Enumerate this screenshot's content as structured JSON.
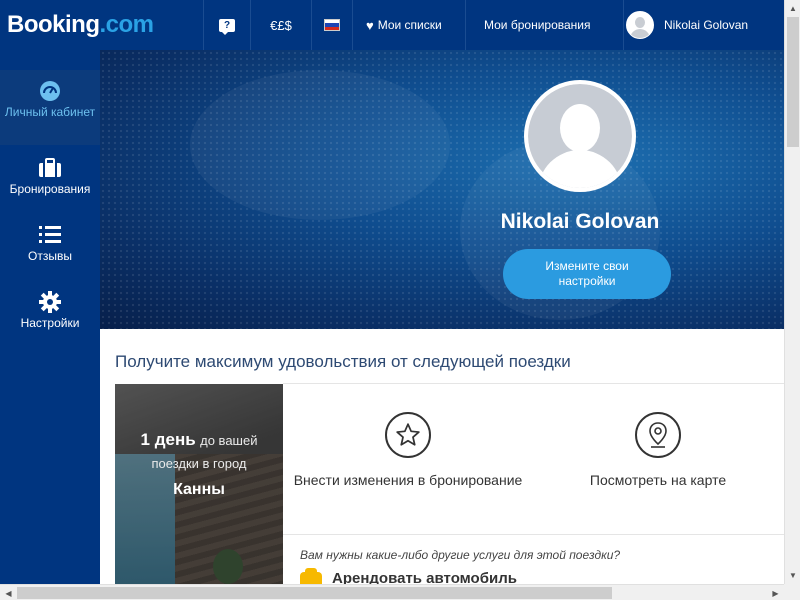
{
  "header": {
    "logo_main": "Booking",
    "logo_suffix": ".com",
    "help_label": "?",
    "currency": "€£$",
    "flag": {
      "colors": [
        "#ffffff",
        "#1c44b5",
        "#d52b1e"
      ]
    },
    "lists_label": "Мои списки",
    "bookings_label": "Мои бронирования",
    "user_name": "Nikolai Golovan"
  },
  "sidebar": {
    "items": [
      {
        "label": "Личный кабинет",
        "icon": "dashboard-icon",
        "active": true
      },
      {
        "label": "Бронирования",
        "icon": "suitcase-icon",
        "active": false
      },
      {
        "label": "Отзывы",
        "icon": "list-icon",
        "active": false
      },
      {
        "label": "Настройки",
        "icon": "gear-icon",
        "active": false
      }
    ]
  },
  "profile": {
    "name": "Nikolai Golovan",
    "settings_button": "Измените свои настройки"
  },
  "trip": {
    "section_title": "Получите максимум удовольствия от следующей поездки",
    "days": "1 день",
    "days_suffix": "до вашей",
    "line2": "поездки в город",
    "city": "Канны"
  },
  "actions": [
    {
      "label": "Внести изменения в бронирование",
      "icon": "star-icon"
    },
    {
      "label": "Посмотреть на карте",
      "icon": "map-pin-icon"
    }
  ],
  "services": {
    "question": "Вам нужны какие-либо другие услуги для этой поездки?",
    "car_rental": "Арендовать автомобиль"
  },
  "colors": {
    "brand_blue": "#003580",
    "accent_blue": "#2b9be0",
    "title_blue": "#2e4a73",
    "car_yellow": "#f7b900"
  }
}
